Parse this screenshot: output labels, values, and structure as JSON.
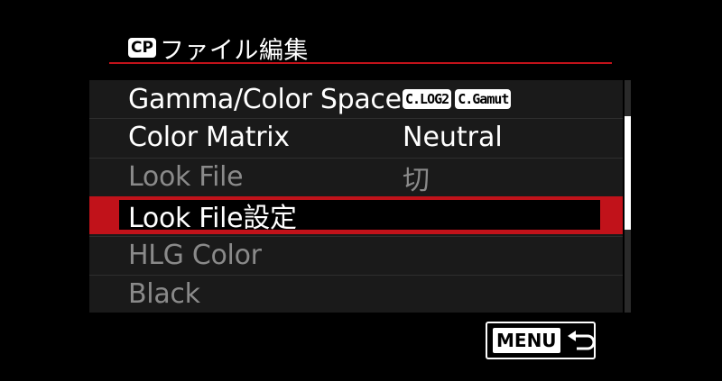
{
  "header": {
    "badge": "CP",
    "title": "ファイル編集"
  },
  "menu": {
    "items": [
      {
        "label": "Gamma/Color Space",
        "tags": [
          "C.LOG2",
          "C.Gamut"
        ],
        "value": "",
        "state": "normal"
      },
      {
        "label": "Color Matrix",
        "tags": [],
        "value": "Neutral",
        "state": "normal"
      },
      {
        "label": "Look File",
        "tags": [],
        "value": "切",
        "state": "disabled"
      },
      {
        "label": "Look File設定",
        "tags": [],
        "value": "",
        "state": "selected"
      },
      {
        "label": "HLG Color",
        "tags": [],
        "value": "",
        "state": "disabled"
      },
      {
        "label": "Black",
        "tags": [],
        "value": "",
        "state": "disabled"
      }
    ]
  },
  "scroll": {
    "position_fraction": 0.0,
    "visible_fraction": 0.5
  },
  "footer": {
    "menu_button_label": "MENU",
    "back_icon": "return-arrow-icon"
  },
  "colors": {
    "accent": "#c1121a",
    "row_background": "#1a1a1a",
    "disabled_text": "#8a8a8a"
  }
}
